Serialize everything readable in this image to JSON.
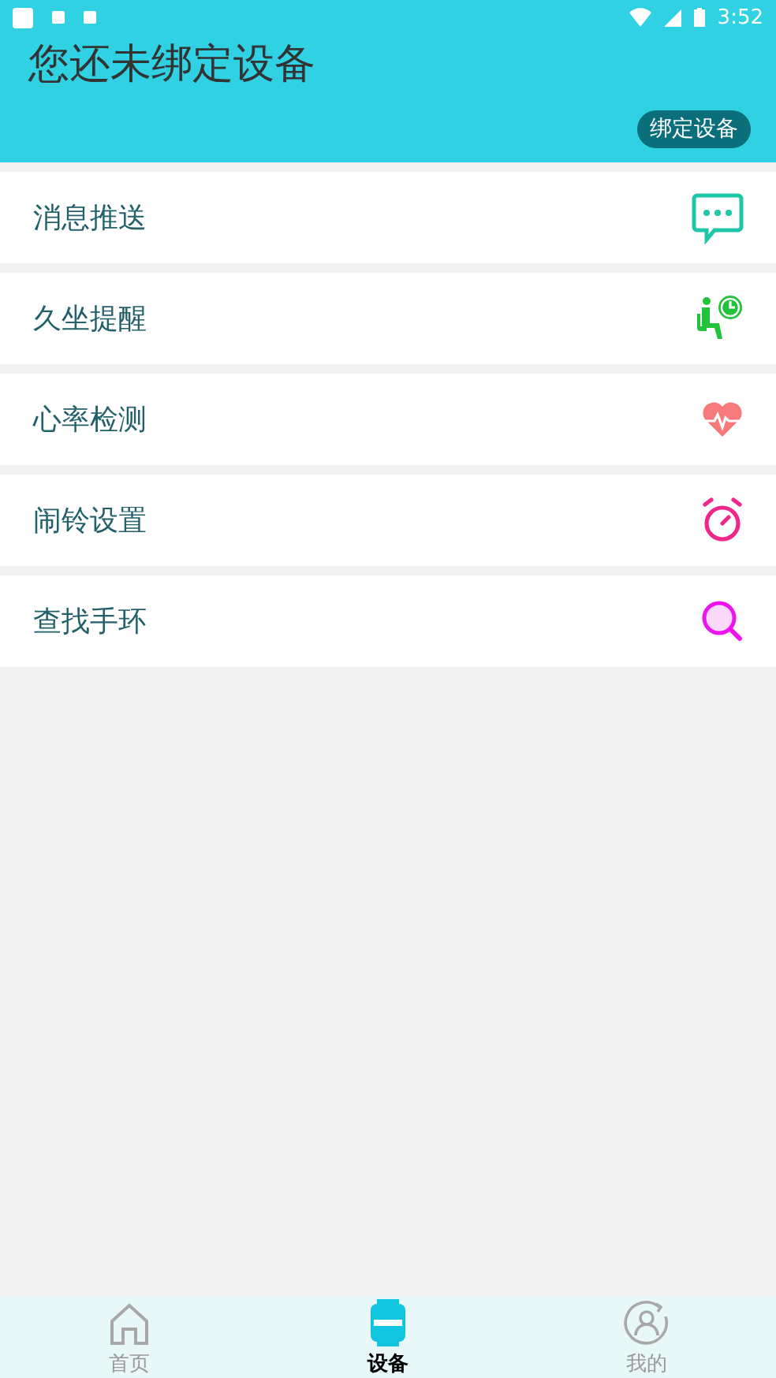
{
  "status_bar": {
    "time": "3:52"
  },
  "header": {
    "title": "您还未绑定设备",
    "bind_button": "绑定设备"
  },
  "menu": [
    {
      "label": "消息推送",
      "kind": "message"
    },
    {
      "label": "久坐提醒",
      "kind": "sitting"
    },
    {
      "label": "心率检测",
      "kind": "heart"
    },
    {
      "label": "闹铃设置",
      "kind": "alarm"
    },
    {
      "label": "查找手环",
      "kind": "search"
    }
  ],
  "bottom_nav": [
    {
      "label": "首页",
      "kind": "home",
      "selected": false
    },
    {
      "label": "设备",
      "kind": "device",
      "selected": true
    },
    {
      "label": "我的",
      "kind": "profile",
      "selected": false
    }
  ]
}
